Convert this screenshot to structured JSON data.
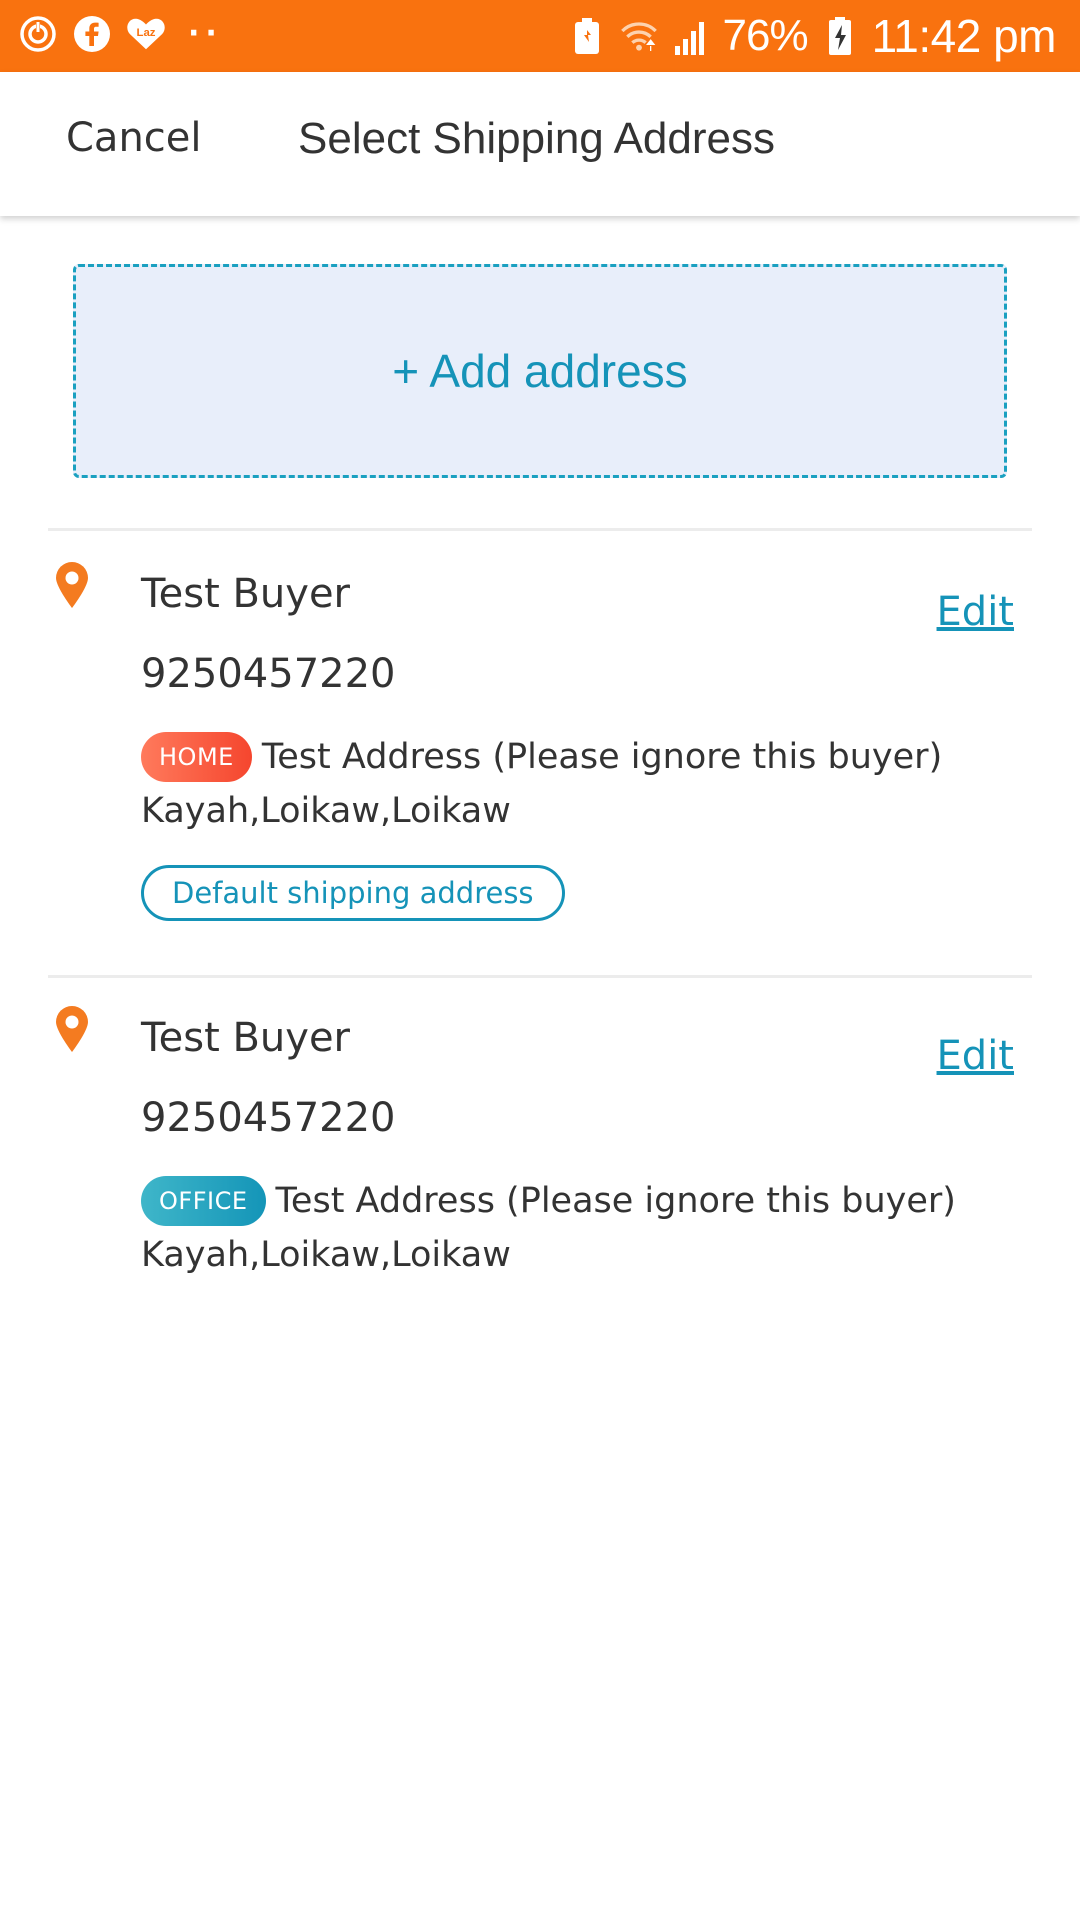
{
  "status_bar": {
    "left_icons": [
      "power-icon",
      "facebook-icon",
      "lazada-heart-icon"
    ],
    "dots": "··",
    "right_icons": [
      "battery-saver-icon",
      "wifi-icon",
      "signal-icon",
      "battery-charging-icon"
    ],
    "battery_percent": "76%",
    "time": "11:42 pm",
    "background_color": "#f9720f"
  },
  "header": {
    "cancel_label": "Cancel",
    "title": "Select Shipping Address"
  },
  "add_address": {
    "label": "+ Add address"
  },
  "addresses": [
    {
      "name": "Test Buyer",
      "phone": "9250457220",
      "tag": "HOME",
      "address_line": "Test Address (Please ignore this buyer)",
      "region": "Kayah,Loikaw,Loikaw",
      "edit_label": "Edit",
      "default_label": "Default shipping address"
    },
    {
      "name": "Test Buyer",
      "phone": "9250457220",
      "tag": "OFFICE",
      "address_line": "Test Address (Please ignore this buyer)",
      "region": "Kayah,Loikaw,Loikaw",
      "edit_label": "Edit"
    }
  ],
  "colors": {
    "accent": "#1593b8",
    "pin": "#f47b20",
    "home_tag": "#f5462e",
    "office_tag": "#1495b8"
  }
}
